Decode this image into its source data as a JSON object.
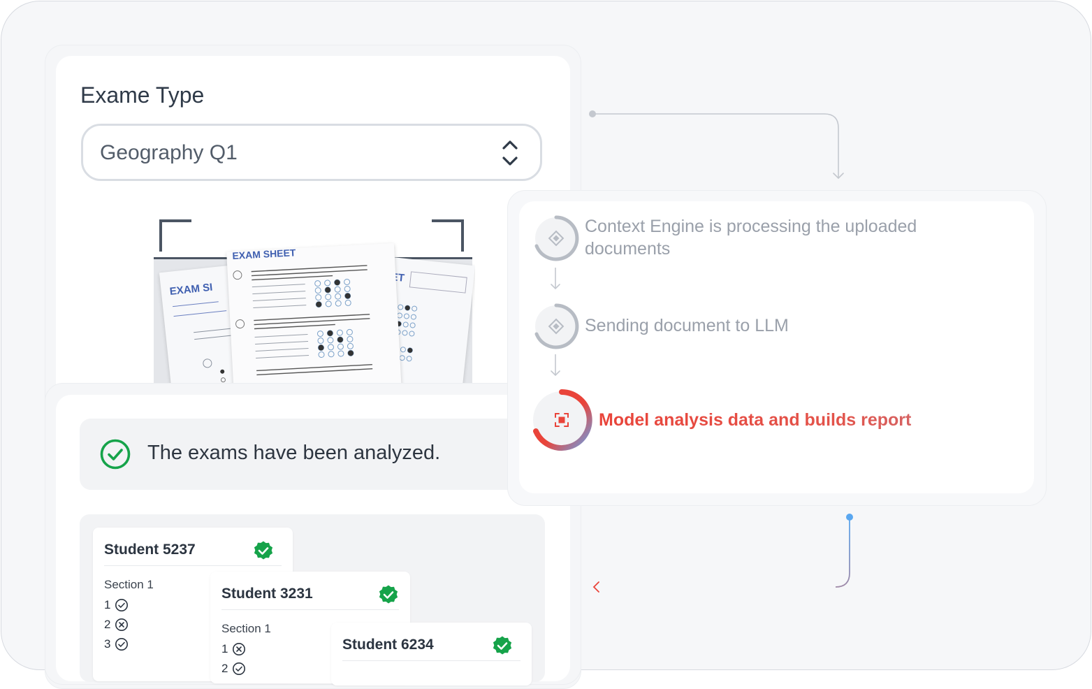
{
  "exam_type": {
    "label": "Exame Type",
    "selected_value": "Geography Q1"
  },
  "scan_preview": {
    "sheet_title": "EXAM SHEET",
    "sheet_title_partial_left": "EXAM SI",
    "sheet_title_partial_right": "EET"
  },
  "notice": {
    "text": "The exams have been analyzed."
  },
  "students": [
    {
      "name": "Student 5237",
      "section": "Section 1",
      "answers": [
        {
          "number": "1",
          "status": "correct"
        },
        {
          "number": "2",
          "status": "wrong"
        },
        {
          "number": "3",
          "status": "correct"
        }
      ]
    },
    {
      "name": "Student 3231",
      "section": "Section 1",
      "answers": [
        {
          "number": "1",
          "status": "wrong"
        },
        {
          "number": "2",
          "status": "correct"
        }
      ]
    },
    {
      "name": "Student 6234"
    }
  ],
  "process_steps": [
    {
      "text": "Context Engine is processing the uploaded documents",
      "state": "done"
    },
    {
      "text": "Sending document to LLM",
      "state": "done"
    },
    {
      "text": "Model analysis data and builds report",
      "state": "active"
    }
  ],
  "colors": {
    "success_green": "#16a34a",
    "active_red": "#e9443a",
    "connector_blue": "#5aa7f0",
    "muted_gray": "#9aa0aa"
  }
}
